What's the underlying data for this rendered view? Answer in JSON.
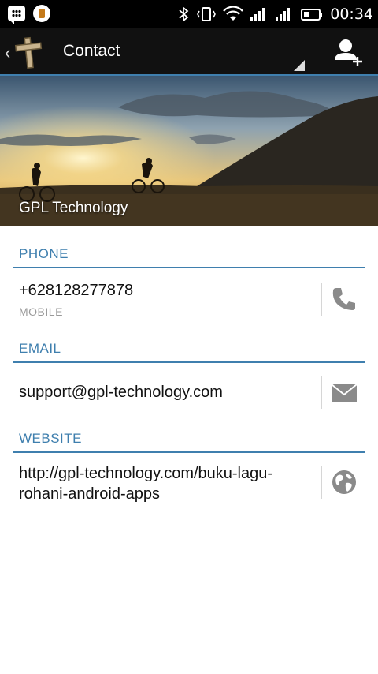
{
  "status_bar": {
    "time": "00:34",
    "left_icons": [
      "bbm-icon",
      "app-notification-icon"
    ],
    "right_icons": [
      "bluetooth-icon",
      "vibrate-icon",
      "wifi-icon",
      "signal-1-icon",
      "signal-2-icon",
      "battery-icon"
    ]
  },
  "action_bar": {
    "title": "Contact"
  },
  "hero": {
    "name": "GPL Technology"
  },
  "sections": {
    "phone": {
      "header": "PHONE",
      "value": "+628128277878",
      "type": "MOBILE"
    },
    "email": {
      "header": "EMAIL",
      "value": "support@gpl-technology.com"
    },
    "website": {
      "header": "WEBSITE",
      "value_line1": "http://gpl-technology.com/buku-lagu-",
      "value_line2": "rohani-android-apps"
    }
  },
  "colors": {
    "accent": "#3f7fae",
    "action_bar": "#111111",
    "icon_gray": "#8a8a8a"
  }
}
